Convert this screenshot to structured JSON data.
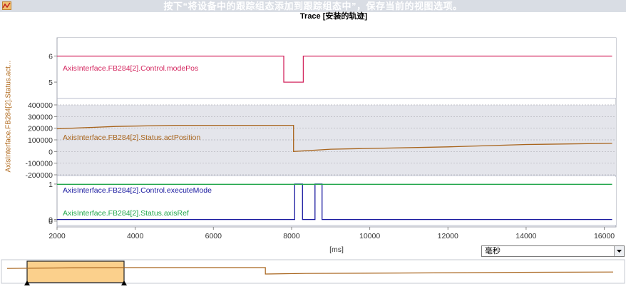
{
  "banner": "按下“将设备中的跟踪组态添加到跟踪组态中”，保存当前的视图选项。",
  "title": "Trace [安装的轨迹]",
  "left_axis_label": "AxisInterface.FB284[2].Status.act...",
  "icons": {
    "trace": "trace-icon",
    "dropdown": "chevron-down-icon"
  },
  "colors": {
    "modePos": "#d42860",
    "actPosition": "#a8641c",
    "executeMode": "#1a1aa0",
    "axisRef": "#21a64a",
    "overview_fill": "#fbd08c"
  },
  "time_unit_select": {
    "value": "毫秒"
  },
  "chart_data": {
    "type": "line",
    "xlabel": "[ms]",
    "x_ticks": [
      "2000",
      "4000",
      "6000",
      "8000",
      "10000",
      "12000",
      "14000",
      "16000"
    ],
    "xlim": [
      2000,
      16300
    ],
    "series": [
      {
        "name": "AxisInterface.FB284[2].Control.modePos",
        "y_ticks": [
          "6",
          "5"
        ],
        "ylim": [
          4.4,
          6.7
        ],
        "step": true,
        "points": [
          [
            2000,
            6
          ],
          [
            7800,
            6
          ],
          [
            7800,
            5
          ],
          [
            8300,
            5
          ],
          [
            8300,
            6
          ],
          [
            16200,
            6
          ]
        ]
      },
      {
        "name": "AxisInterface.FB284[2].Status.actPosition",
        "y_ticks": [
          "400000",
          "300000",
          "200000",
          "100000",
          "0",
          "-100000",
          "-200000"
        ],
        "ylim": [
          -200000,
          400000
        ],
        "points": [
          [
            2000,
            195000
          ],
          [
            3500,
            215000
          ],
          [
            5000,
            225000
          ],
          [
            8050,
            225000
          ],
          [
            8050,
            0
          ],
          [
            9000,
            20000
          ],
          [
            12000,
            40000
          ],
          [
            14000,
            60000
          ],
          [
            16200,
            70000
          ]
        ]
      },
      {
        "name": "AxisInterface.FB284[2].Control.executeMode",
        "y_ticks": [
          "1",
          "0"
        ],
        "ylim": [
          -0.15,
          1.2
        ],
        "step": true,
        "points": [
          [
            2000,
            0
          ],
          [
            8080,
            0
          ],
          [
            8080,
            1
          ],
          [
            8280,
            1
          ],
          [
            8280,
            0
          ],
          [
            8600,
            0
          ],
          [
            8600,
            1
          ],
          [
            8780,
            1
          ],
          [
            8780,
            0
          ],
          [
            16200,
            0
          ]
        ]
      },
      {
        "name": "AxisInterface.FB284[2].Status.axisRef",
        "y_ticks": [
          "0"
        ],
        "ylim": [
          -0.1,
          1.2
        ],
        "step": true,
        "points": [
          [
            2000,
            1
          ],
          [
            16200,
            1
          ]
        ]
      }
    ]
  }
}
